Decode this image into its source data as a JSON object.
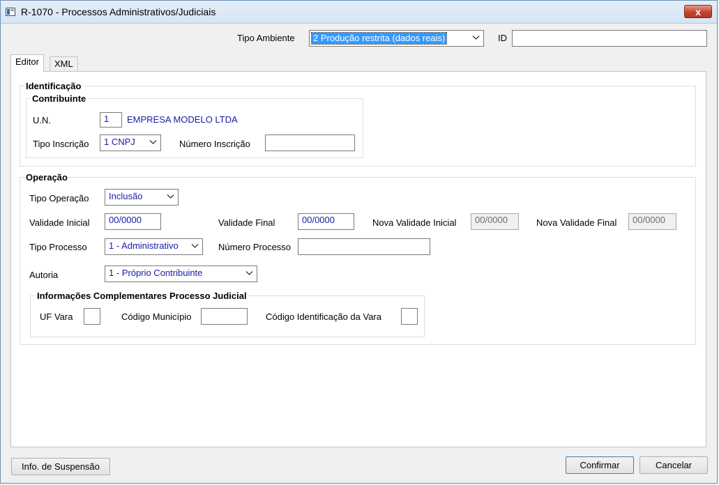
{
  "window": {
    "title": "R-1070 - Processos Administrativos/Judiciais",
    "close_glyph": "x"
  },
  "header": {
    "tipo_ambiente_label": "Tipo Ambiente",
    "tipo_ambiente_value": "2 Produção restrita (dados reais)",
    "id_label": "ID",
    "id_value": ""
  },
  "tabs": [
    {
      "label": "Editor",
      "active": true
    },
    {
      "label": "XML",
      "active": false
    }
  ],
  "identificacao": {
    "title": "Identificação",
    "contribuinte": {
      "title": "Contribuinte",
      "un_label": "U.N.",
      "un_value": "1",
      "empresa": "EMPRESA MODELO LTDA",
      "tipo_inscricao_label": "Tipo Inscrição",
      "tipo_inscricao_value": "1 CNPJ",
      "numero_inscricao_label": "Número Inscrição",
      "numero_inscricao_value": ""
    }
  },
  "operacao": {
    "title": "Operação",
    "tipo_operacao_label": "Tipo Operação",
    "tipo_operacao_value": "Inclusão",
    "validade_inicial_label": "Validade Inicial",
    "validade_inicial_value": "00/0000",
    "validade_final_label": "Validade Final",
    "validade_final_value": "00/0000",
    "nova_validade_inicial_label": "Nova Validade Inicial",
    "nova_validade_inicial_value": "00/0000",
    "nova_validade_final_label": "Nova Validade Final",
    "nova_validade_final_value": "00/0000",
    "tipo_processo_label": "Tipo Processo",
    "tipo_processo_value": "1 - Administrativo",
    "numero_processo_label": "Número Processo",
    "numero_processo_value": "",
    "autoria_label": "Autoria",
    "autoria_value": "1 - Próprio Contribuinte",
    "info_judicial": {
      "title": "Informações Complementares Processo Judicial",
      "uf_vara_label": "UF Vara",
      "uf_vara_value": "",
      "codigo_municipio_label": "Código Município",
      "codigo_municipio_value": "",
      "codigo_vara_label": "Código Identificação da Vara",
      "codigo_vara_value": ""
    }
  },
  "footer": {
    "suspensao_label": "Info. de Suspensão",
    "confirmar_label": "Confirmar",
    "cancelar_label": "Cancelar"
  },
  "colors": {
    "accent_selection": "#3399ff",
    "value_text": "#1a1aa6",
    "close_button": "#c2442b"
  }
}
